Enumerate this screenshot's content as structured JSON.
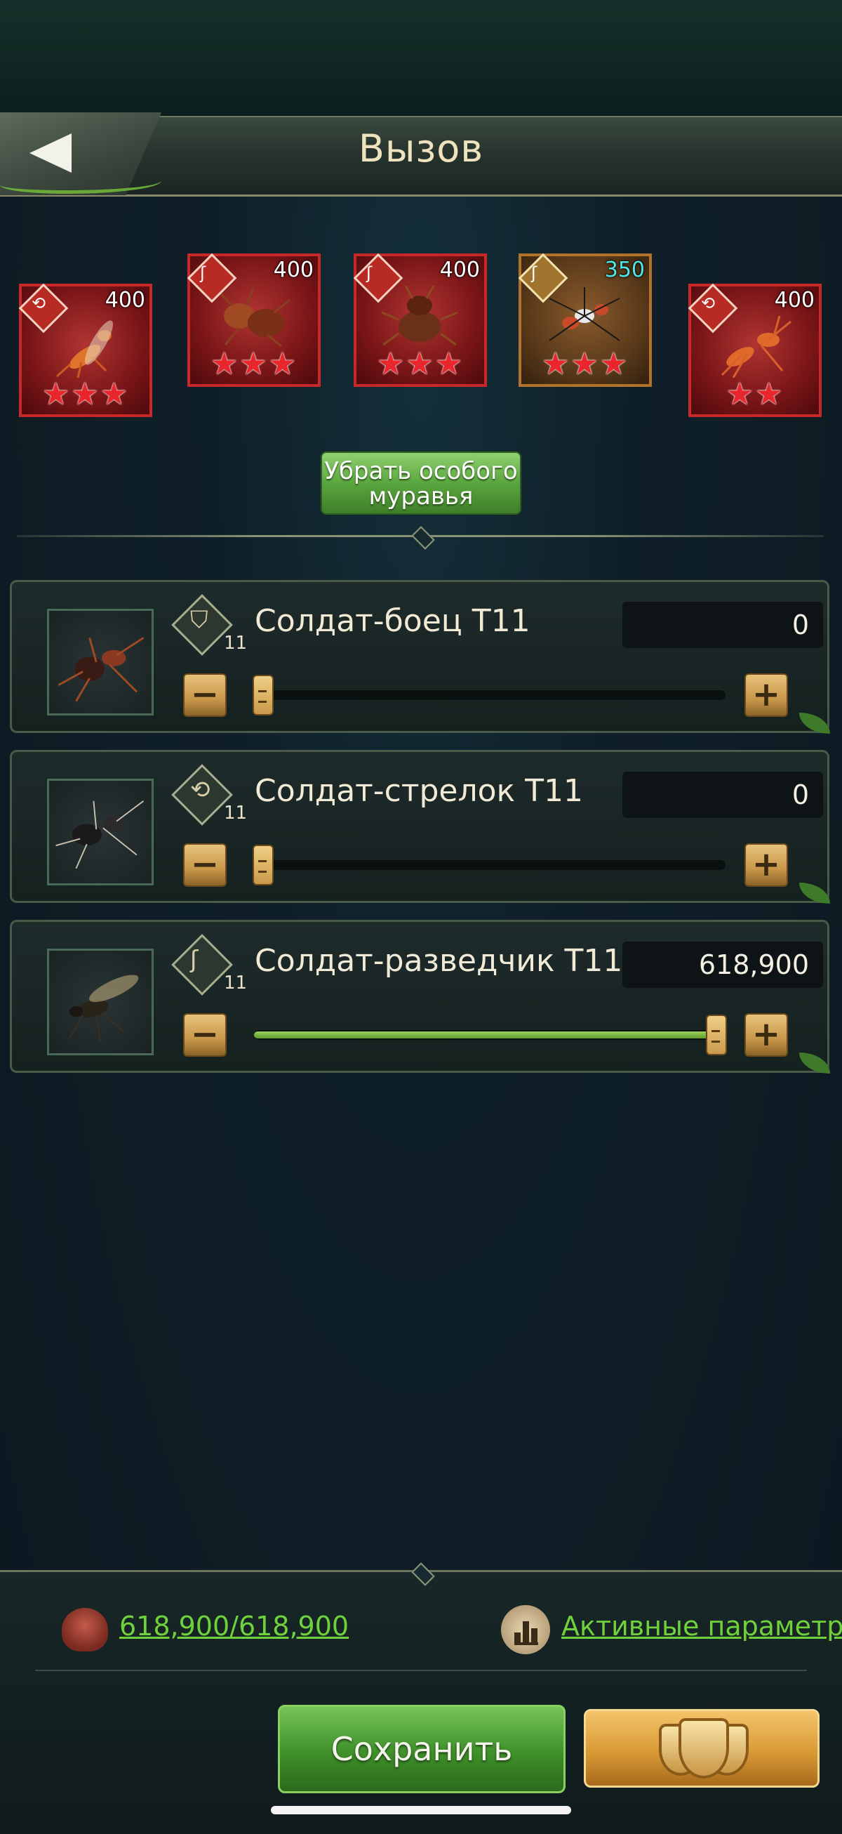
{
  "header": {
    "title": "Вызов"
  },
  "special_ants": [
    {
      "power": "400",
      "stars": "★★★",
      "frame": "red",
      "badge_icon": "ranged-icon"
    },
    {
      "power": "400",
      "stars": "★★★",
      "frame": "red",
      "badge_icon": "scout-icon"
    },
    {
      "power": "400",
      "stars": "★★★",
      "frame": "red",
      "badge_icon": "scout-icon"
    },
    {
      "power": "350",
      "stars": "★★★",
      "frame": "gold",
      "badge_icon": "scout-icon",
      "power_color": "#4ee8e8"
    },
    {
      "power": "400",
      "stars": "★★",
      "frame": "red",
      "badge_icon": "ranged-icon"
    }
  ],
  "remove_button": {
    "label_line1": "Убрать особого",
    "label_line2": "муравья"
  },
  "troops": [
    {
      "name": "Солдат-боец T11",
      "level": "11",
      "count": "0",
      "icon": "shield-icon",
      "fill": 0.0
    },
    {
      "name": "Солдат-стрелок T11",
      "level": "11",
      "count": "0",
      "icon": "ranged-icon",
      "fill": 0.0
    },
    {
      "name": "Солдат-разведчик T11",
      "level": "11",
      "count": "618,900",
      "icon": "scout-icon",
      "fill": 1.0
    }
  ],
  "footer": {
    "capacity": "618,900/618,900",
    "active_params": "Активные параметры",
    "save_label": "Сохранить"
  },
  "colors": {
    "accent_green": "#6fd13c",
    "frame_red": "#c8282a",
    "frame_gold": "#b2722a",
    "star_red": "#e8262c"
  }
}
